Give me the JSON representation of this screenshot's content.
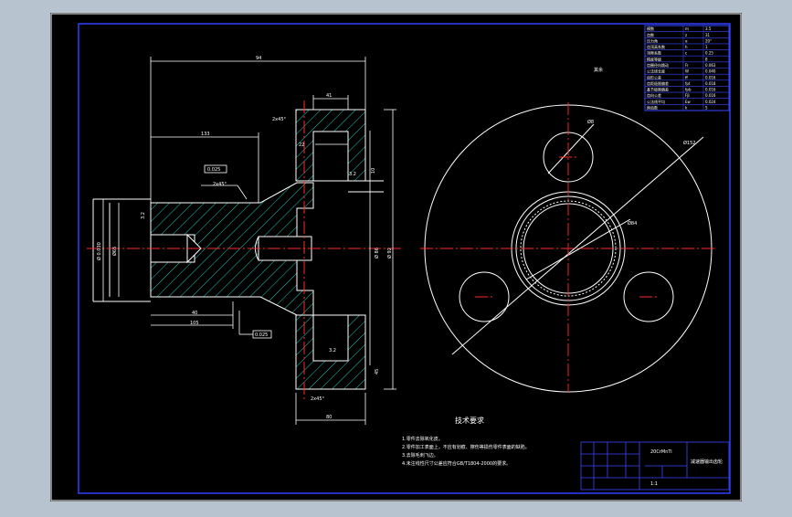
{
  "colors": {
    "background": "#b8c3d0",
    "canvas": "#000000",
    "frame": "#2f3fff",
    "outline": "#ffffff",
    "hatch": "#22c7b8",
    "centerline": "#ff2a2a",
    "table": "#3a46ff",
    "dimension": "#ffffff"
  },
  "side_view": {
    "dim_total_length": "94",
    "dim_hub_length": "133",
    "dim_flange_thickness": "41",
    "dim_small_a": "2x45°",
    "dim_small_b": "2x45°",
    "dim_small_c": "22",
    "dim_small_d": "10",
    "dim_bottom_a": "40",
    "dim_bottom_b": "105",
    "dim_bottom_c": "2x45°",
    "dim_bottom_d": "45",
    "dim_bottom_e": "80",
    "dim_vert_left": "Ø 0.030",
    "dim_vert_mid": "Ø65",
    "dim_vert_hub": "Ø 86",
    "dim_vert_right": "Ø 92",
    "tolerance_box_top": "0.025",
    "tolerance_box_bottom": "0.025",
    "roughness_a": "3.2",
    "roughness_b": "3.2",
    "roughness_c": "3.2"
  },
  "front_view": {
    "roughness_note": "其余",
    "dim_hole": "Ø8",
    "dim_bolt_circle": "Ø152",
    "dim_bore": "Ø84"
  },
  "param_table": {
    "rows": [
      [
        "模数",
        "m",
        "3.5"
      ],
      [
        "齿数",
        "z",
        "31"
      ],
      [
        "压力角",
        "α",
        "20°"
      ],
      [
        "齿顶高系数",
        "h",
        "1"
      ],
      [
        "顶隙系数",
        "c",
        "0.25"
      ],
      [
        "精度等级",
        "",
        "8"
      ],
      [
        "齿圈径向跳动",
        "Fr",
        "0.063"
      ],
      [
        "公法线长度",
        "W",
        "0.040"
      ],
      [
        "齿形公差",
        "ff",
        "0.016"
      ],
      [
        "齿距极限偏差",
        "fpt",
        "0.018"
      ],
      [
        "基节极限偏差",
        "fpb",
        "0.016"
      ],
      [
        "齿向公差",
        "Fβ",
        "0.016"
      ],
      [
        "公法线平均",
        "Ew",
        "0.024"
      ],
      [
        "跨齿数",
        "k",
        "5"
      ]
    ]
  },
  "tech_requirements": {
    "title": "技术要求",
    "items": [
      "1.零件去除氧化皮。",
      "2.零件加工表面上，不应有划痕、擦伤等损伤零件表面的缺陷。",
      "3.去除毛刺飞边。",
      "4.未注线性尺寸公差应符合GB/T1804-2000的要求。"
    ]
  },
  "title_block": {
    "material": "20CrMnTi",
    "drawing_name": "减速器输出齿轮",
    "scale": "1:1"
  }
}
